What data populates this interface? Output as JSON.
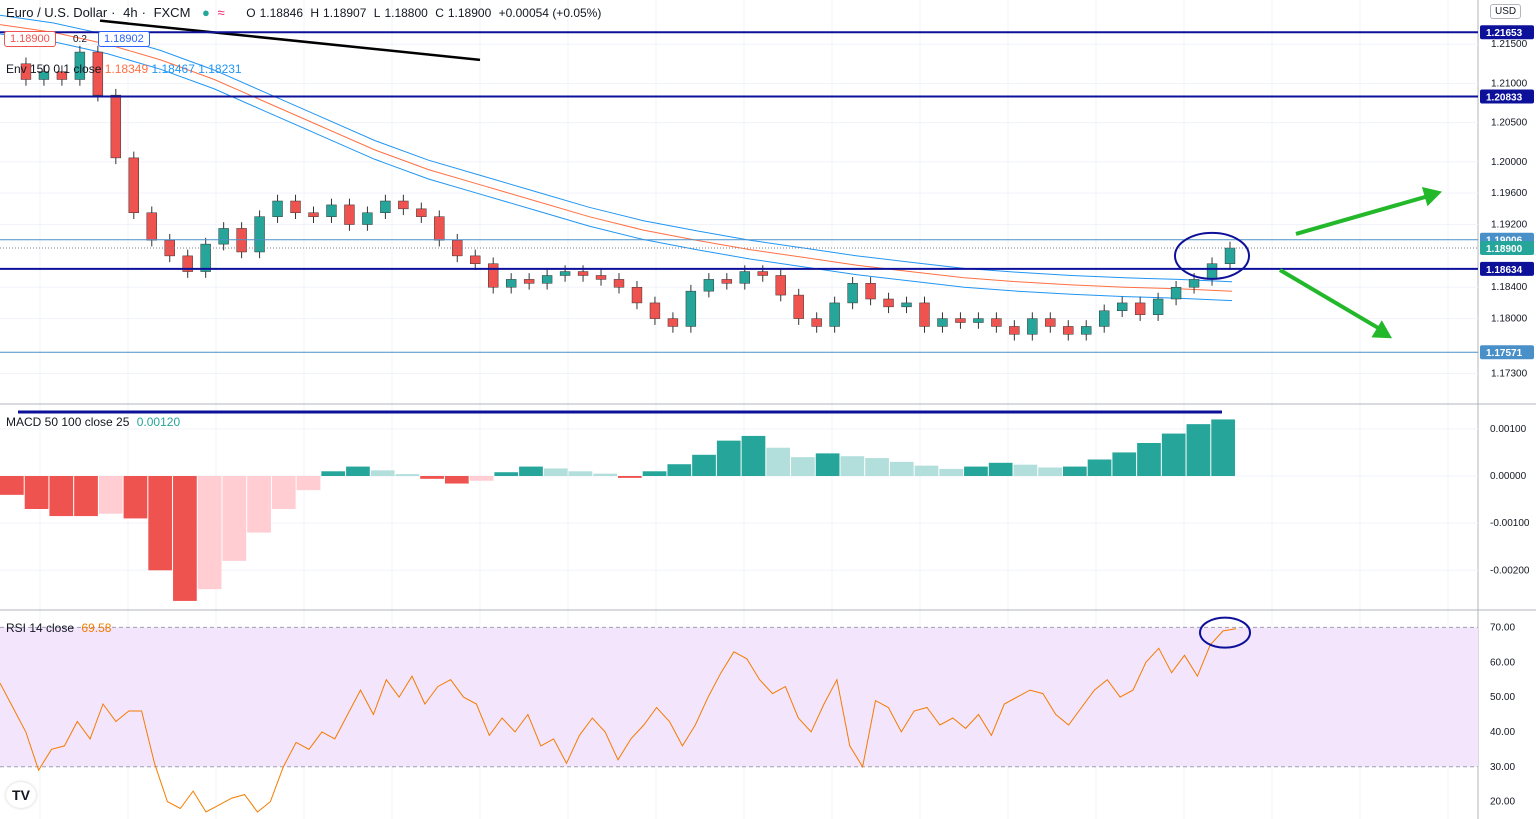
{
  "header": {
    "symbol": "Euro / U.S. Dollar",
    "interval": "4h",
    "exchange": "FXCM",
    "open_label": "O",
    "open": "1.18846",
    "high_label": "H",
    "high": "1.18907",
    "low_label": "L",
    "low": "1.18800",
    "close_label": "C",
    "close": "1.18900",
    "change": "+0.00054 (+0.05%)",
    "sell_price": "1.18900",
    "spread": "0.2",
    "buy_price": "1.18902"
  },
  "envelope_legend": {
    "label": "Env 150 0.1 close",
    "basis": "1.18349",
    "upper": "1.18467",
    "lower": "1.18231"
  },
  "macd_legend": {
    "label": "MACD 50 100 close 25",
    "value": "0.00120"
  },
  "rsi_legend": {
    "label": "RSI 14 close",
    "value": "69.58"
  },
  "currency_button": "USD",
  "logo_text": "TV",
  "colors": {
    "up": "#26a69a",
    "down": "#ef5350",
    "hist_up_strong": "#26a69a",
    "hist_up_weak": "#b2dfdb",
    "hist_down_strong": "#ef5350",
    "hist_down_weak": "#ffcdd2",
    "env_band": "#2196f3",
    "env_basis": "#ff7043",
    "level_line": "#0d1199",
    "arrow": "#22b82a",
    "rsi_line": "#f57c00",
    "rsi_band": "#f3e5fc"
  },
  "chart_data": [
    {
      "type": "candlestick",
      "ylim": [
        1.17,
        1.22
      ],
      "y_ticks": [
        {
          "label": "1.21500",
          "value": 1.215
        },
        {
          "label": "1.21000",
          "value": 1.21
        },
        {
          "label": "1.20500",
          "value": 1.205
        },
        {
          "label": "1.20000",
          "value": 1.2
        },
        {
          "label": "1.19600",
          "value": 1.196
        },
        {
          "label": "1.19200",
          "value": 1.192
        },
        {
          "label": "1.18400",
          "value": 1.184
        },
        {
          "label": "1.18000",
          "value": 1.18
        },
        {
          "label": "1.17300",
          "value": 1.173
        }
      ],
      "price_levels": [
        {
          "label": "1.21653",
          "value": 1.21653,
          "kind": "horizontal-line"
        },
        {
          "label": "1.20833",
          "value": 1.20833,
          "kind": "horizontal-line"
        },
        {
          "label": "1.18634",
          "value": 1.18634,
          "kind": "horizontal-line"
        },
        {
          "label": "1.19006",
          "value": 1.19006,
          "kind": "thin-line"
        },
        {
          "label": "1.17571",
          "value": 1.17571,
          "kind": "thin-line"
        },
        {
          "label": "1.18900",
          "value": 1.189,
          "kind": "last-price"
        }
      ],
      "close_path": [
        1.2125,
        1.2105,
        1.2115,
        1.2105,
        1.214,
        1.2085,
        1.2005,
        1.1935,
        1.19,
        1.188,
        1.186,
        1.1895,
        1.1915,
        1.1885,
        1.193,
        1.195,
        1.1935,
        1.193,
        1.1945,
        1.192,
        1.1935,
        1.195,
        1.194,
        1.193,
        1.19,
        1.188,
        1.187,
        1.184,
        1.185,
        1.1845,
        1.1855,
        1.186,
        1.1855,
        1.185,
        1.184,
        1.182,
        1.18,
        1.179,
        1.1835,
        1.185,
        1.1845,
        1.186,
        1.1855,
        1.183,
        1.18,
        1.179,
        1.182,
        1.1845,
        1.1825,
        1.1815,
        1.182,
        1.179,
        1.18,
        1.1795,
        1.18,
        1.179,
        1.178,
        1.18,
        1.179,
        1.178,
        1.179,
        1.181,
        1.182,
        1.1805,
        1.1825,
        1.184,
        1.185,
        1.187,
        1.189
      ],
      "envelope": {
        "basis": [
          1.2175,
          1.2165,
          1.215,
          1.213,
          1.2105,
          1.2075,
          1.2045,
          1.2015,
          1.199,
          1.197,
          1.195,
          1.193,
          1.1913,
          1.19,
          1.1888,
          1.1878,
          1.1868,
          1.186,
          1.1852,
          1.1847,
          1.1843,
          1.184,
          1.1838,
          1.1835
        ],
        "upper_offset": 0.0012,
        "lower_offset": -0.0012
      },
      "trendline": {
        "from": 1.218,
        "to": 1.213
      },
      "arrows": [
        {
          "direction": "up"
        },
        {
          "direction": "down"
        }
      ]
    },
    {
      "type": "histogram",
      "name": "MACD",
      "ylim": [
        -0.0028,
        0.0014
      ],
      "y_ticks": [
        {
          "label": "0.00100",
          "value": 0.001
        },
        {
          "label": "0.00000",
          "value": 0.0
        },
        {
          "label": "-0.00100",
          "value": -0.001
        },
        {
          "label": "-0.00200",
          "value": -0.002
        }
      ],
      "values": [
        -0.0004,
        -0.0007,
        -0.00085,
        -0.00085,
        -0.0008,
        -0.0009,
        -0.002,
        -0.00265,
        -0.0024,
        -0.0018,
        -0.0012,
        -0.0007,
        -0.0003,
        0.0001,
        0.0002,
        0.00012,
        4e-05,
        -6e-05,
        -0.00016,
        -0.0001,
        8e-05,
        0.0002,
        0.00016,
        0.0001,
        5e-05,
        -4e-05,
        0.0001,
        0.00025,
        0.00045,
        0.00075,
        0.00085,
        0.0006,
        0.0004,
        0.00048,
        0.00042,
        0.00038,
        0.0003,
        0.00022,
        0.00015,
        0.0002,
        0.00028,
        0.00024,
        0.00018,
        0.0002,
        0.00035,
        0.0005,
        0.0007,
        0.0009,
        0.0011,
        0.0012
      ]
    },
    {
      "type": "line",
      "name": "RSI",
      "ylim": [
        15,
        75
      ],
      "band": [
        30,
        70
      ],
      "y_ticks": [
        {
          "label": "70.00",
          "value": 70
        },
        {
          "label": "60.00",
          "value": 60
        },
        {
          "label": "50.00",
          "value": 50
        },
        {
          "label": "40.00",
          "value": 40
        },
        {
          "label": "30.00",
          "value": 30
        },
        {
          "label": "20.00",
          "value": 20
        }
      ],
      "values": [
        54,
        47,
        40,
        29,
        35,
        36,
        43,
        38,
        48,
        43,
        46,
        46,
        31,
        20,
        18,
        23,
        17,
        19,
        21,
        22,
        17,
        20,
        30,
        37,
        35,
        40,
        38,
        45,
        52,
        45,
        55,
        50,
        56,
        48,
        53,
        55,
        50,
        48,
        39,
        44,
        40,
        45,
        36,
        38,
        31,
        39,
        44,
        40,
        32,
        38,
        42,
        47,
        43,
        36,
        42,
        50,
        57,
        63,
        61,
        55,
        51,
        53,
        44,
        40,
        48,
        55,
        36,
        30,
        49,
        47,
        40,
        46,
        47,
        42,
        44,
        41,
        45,
        39,
        48,
        50,
        52,
        51,
        45,
        42,
        47,
        52,
        55,
        50,
        52,
        60,
        64,
        57,
        62,
        56,
        65,
        69,
        69.6
      ]
    }
  ]
}
